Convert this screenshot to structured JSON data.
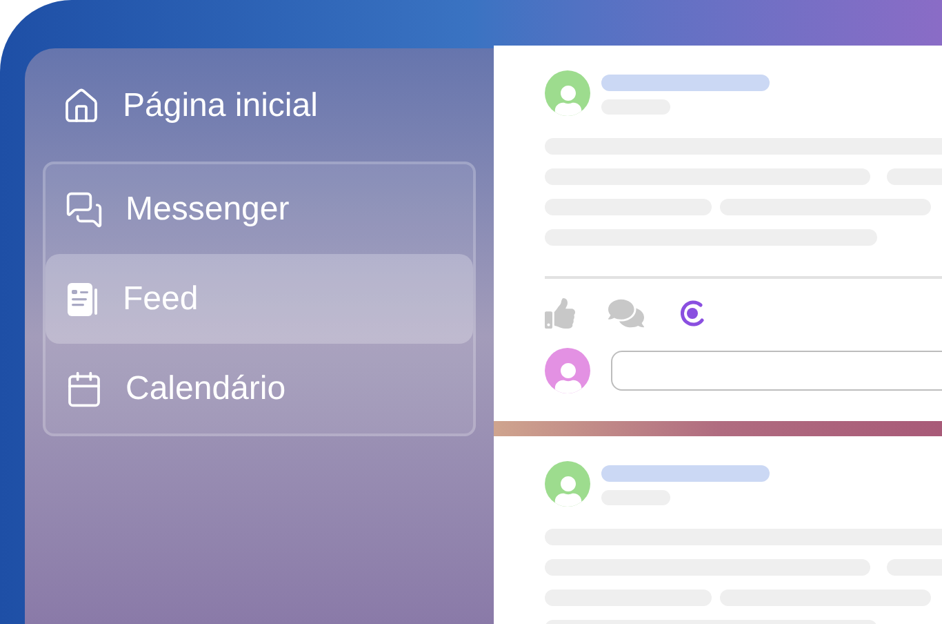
{
  "sidebar": {
    "home": {
      "label": "Página inicial"
    },
    "items": [
      {
        "label": "Messenger",
        "selected": false
      },
      {
        "label": "Feed",
        "selected": true
      },
      {
        "label": "Calendário",
        "selected": false
      }
    ]
  },
  "feed": {
    "posts": [
      {
        "actions": true
      },
      {
        "actions": false
      }
    ]
  }
}
